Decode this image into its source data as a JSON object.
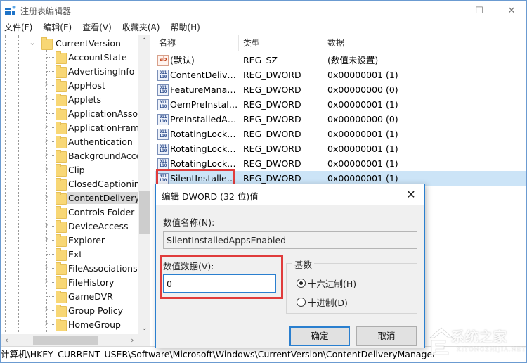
{
  "window": {
    "title": "注册表编辑器",
    "controls": {
      "minimize": "—",
      "maximize": "☐",
      "close": "✕"
    }
  },
  "menu": [
    "文件(F)",
    "编辑(E)",
    "查看(V)",
    "收藏夹(A)",
    "帮助(H)"
  ],
  "tree": {
    "parent": {
      "label": "CurrentVersion",
      "expanded": true
    },
    "children": [
      {
        "label": "AccountState",
        "expandable": false
      },
      {
        "label": "AdvertisingInfo",
        "expandable": false
      },
      {
        "label": "AppHost",
        "expandable": true
      },
      {
        "label": "Applets",
        "expandable": true
      },
      {
        "label": "ApplicationAssoc",
        "expandable": false
      },
      {
        "label": "ApplicationFrame",
        "expandable": true
      },
      {
        "label": "Authentication",
        "expandable": true
      },
      {
        "label": "BackgroundAcce",
        "expandable": true
      },
      {
        "label": "Clip",
        "expandable": true
      },
      {
        "label": "ClosedCaptioning",
        "expandable": false
      },
      {
        "label": "ContentDeliveryM",
        "expandable": true,
        "selected": true
      },
      {
        "label": "Controls Folder",
        "expandable": false
      },
      {
        "label": "DeviceAccess",
        "expandable": true
      },
      {
        "label": "Explorer",
        "expandable": true
      },
      {
        "label": "Ext",
        "expandable": false
      },
      {
        "label": "FileAssociations",
        "expandable": true
      },
      {
        "label": "FileHistory",
        "expandable": true
      },
      {
        "label": "GameDVR",
        "expandable": false
      },
      {
        "label": "Group Policy",
        "expandable": true
      },
      {
        "label": "HomeGroup",
        "expandable": true
      }
    ]
  },
  "list": {
    "headers": {
      "name": "名称",
      "type": "类型",
      "data": "数据"
    },
    "rows": [
      {
        "icon": "string-value-icon",
        "glyph": "ab",
        "name": "(默认)",
        "type": "REG_SZ",
        "data": "(数值未设置)"
      },
      {
        "icon": "binary-value-icon",
        "glyph": "011\n110",
        "name": "ContentDeliver...",
        "type": "REG_DWORD",
        "data": "0x00000001 (1)"
      },
      {
        "icon": "binary-value-icon",
        "glyph": "011\n110",
        "name": "FeatureManag...",
        "type": "REG_DWORD",
        "data": "0x00000000 (0)"
      },
      {
        "icon": "binary-value-icon",
        "glyph": "011\n110",
        "name": "OemPreInstall...",
        "type": "REG_DWORD",
        "data": "0x00000001 (1)"
      },
      {
        "icon": "binary-value-icon",
        "glyph": "011\n110",
        "name": "PreInstalledAp...",
        "type": "REG_DWORD",
        "data": "0x00000000 (0)"
      },
      {
        "icon": "binary-value-icon",
        "glyph": "011\n110",
        "name": "RotatingLockS...",
        "type": "REG_DWORD",
        "data": "0x00000001 (1)"
      },
      {
        "icon": "binary-value-icon",
        "glyph": "011\n110",
        "name": "RotatingLockS...",
        "type": "REG_DWORD",
        "data": "0x00000001 (1)"
      },
      {
        "icon": "binary-value-icon",
        "glyph": "011\n110",
        "name": "RotatingLockS...",
        "type": "REG_DWORD",
        "data": "0x00000001 (1)"
      },
      {
        "icon": "binary-value-icon",
        "glyph": "011\n110",
        "name": "SilentInstalled...",
        "type": "REG_DWORD",
        "data": "0x00000001 (1)",
        "selected": true
      }
    ]
  },
  "statusbar": {
    "path": "计算机\\HKEY_CURRENT_USER\\Software\\Microsoft\\Windows\\CurrentVersion\\ContentDeliveryManager"
  },
  "dialog": {
    "title": "编辑 DWORD (32 位)值",
    "close": "✕",
    "name_label": "数值名称(N):",
    "name_value": "SilentInstalledAppsEnabled",
    "data_label": "数值数据(V):",
    "data_value": "0",
    "base_label": "基数",
    "base_options": [
      {
        "label": "十六进制(H)",
        "checked": true
      },
      {
        "label": "十进制(D)",
        "checked": false
      }
    ],
    "ok_label": "确定",
    "cancel_label": "取消"
  },
  "watermark": {
    "text": "系统之家",
    "sub": "XITONGZHIJIA.NET"
  },
  "colors": {
    "accent": "#2a7fcf",
    "highlight_red": "#e03c3c",
    "selection": "#cce4f7",
    "folder": "#f8d775"
  }
}
